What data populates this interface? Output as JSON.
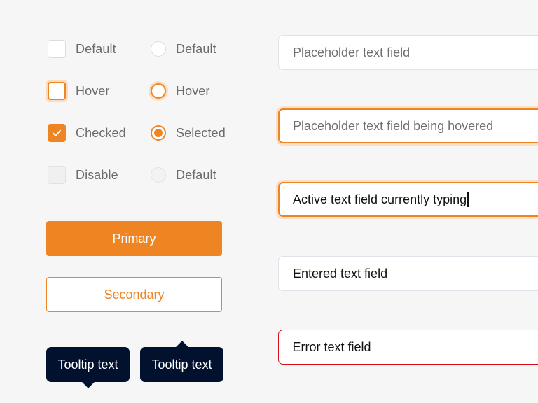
{
  "theme": {
    "accent": "#ef8423",
    "error": "#d40f1a",
    "tooltip_bg": "#02112e",
    "background": "#f6f6f7"
  },
  "checkboxes": [
    {
      "label": "Default",
      "state": "default"
    },
    {
      "label": "Hover",
      "state": "hover"
    },
    {
      "label": "Checked",
      "state": "checked",
      "icon": "check-icon"
    },
    {
      "label": "Disable",
      "state": "disabled"
    }
  ],
  "radios": [
    {
      "label": "Default",
      "state": "default"
    },
    {
      "label": "Hover",
      "state": "hover"
    },
    {
      "label": "Selected",
      "state": "selected"
    },
    {
      "label": "Default",
      "state": "disabled"
    }
  ],
  "buttons": {
    "primary": "Primary",
    "secondary": "Secondary"
  },
  "tooltips": [
    {
      "text": "Tooltip text",
      "arrow": "bottom"
    },
    {
      "text": "Tooltip text",
      "arrow": "top"
    }
  ],
  "fields": [
    {
      "state": "default",
      "value": "",
      "placeholder": "Placeholder text field"
    },
    {
      "state": "hover",
      "value": "",
      "placeholder": "Placeholder text field being hovered"
    },
    {
      "state": "active",
      "value": "Active text field currently typing",
      "placeholder": ""
    },
    {
      "state": "entered",
      "value": "Entered text field",
      "placeholder": ""
    },
    {
      "state": "error",
      "value": "Error text field",
      "placeholder": ""
    }
  ]
}
